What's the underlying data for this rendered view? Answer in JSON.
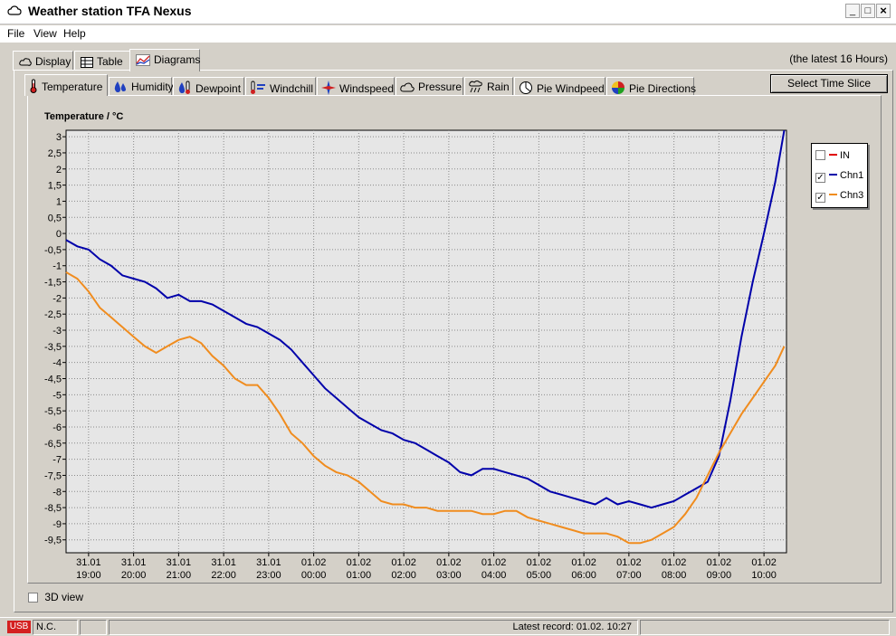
{
  "window": {
    "title": "Weather station TFA Nexus"
  },
  "menu": [
    "File",
    "View",
    "Help"
  ],
  "main_tabs": [
    {
      "label": "Display",
      "icon": "sun-icon"
    },
    {
      "label": "Table",
      "icon": "table-icon"
    },
    {
      "label": "Diagrams",
      "icon": "diagram-icon"
    }
  ],
  "latest_label": "(the latest 16 Hours)",
  "sub_tabs": [
    {
      "label": "Temperature",
      "icon": "thermometer-icon"
    },
    {
      "label": "Humidity",
      "icon": "humidity-icon"
    },
    {
      "label": "Dewpoint",
      "icon": "dewpoint-icon"
    },
    {
      "label": "Windchill",
      "icon": "windchill-icon"
    },
    {
      "label": "Windspeed",
      "icon": "windspeed-icon"
    },
    {
      "label": "Pressure",
      "icon": "pressure-icon"
    },
    {
      "label": "Rain",
      "icon": "rain-icon"
    },
    {
      "label": "Pie Windpeed",
      "icon": "pie-icon"
    },
    {
      "label": "Pie Directions",
      "icon": "compass-icon"
    }
  ],
  "select_button": "Select Time Slice",
  "view3d_label": "3D view",
  "status": {
    "usb": "USB",
    "connection": "N.C.",
    "latest_record": "Latest record: 01.02. 10:27"
  },
  "colors": {
    "chn1": "#0000aa",
    "chn3": "#f08c1e",
    "in": "#e00000",
    "plot_bg": "#e6e6e6"
  },
  "chart_data": {
    "type": "line",
    "title": "Temperature / °C",
    "ylim": [
      -9.9,
      3.2
    ],
    "yticks": [
      "3",
      "2,5",
      "2",
      "1,5",
      "1",
      "0,5",
      "0",
      "-0,5",
      "-1",
      "-1,5",
      "-2",
      "-2,5",
      "-3",
      "-3,5",
      "-4",
      "-4,5",
      "-5",
      "-5,5",
      "-6",
      "-6,5",
      "-7",
      "-7,5",
      "-8",
      "-8,5",
      "-9",
      "-9,5"
    ],
    "xlim": [
      18.5,
      10.5
    ],
    "xticks": [
      {
        "date": "31.01",
        "time": "19:00"
      },
      {
        "date": "31.01",
        "time": "20:00"
      },
      {
        "date": "31.01",
        "time": "21:00"
      },
      {
        "date": "31.01",
        "time": "22:00"
      },
      {
        "date": "31.01",
        "time": "23:00"
      },
      {
        "date": "01.02",
        "time": "00:00"
      },
      {
        "date": "01.02",
        "time": "01:00"
      },
      {
        "date": "01.02",
        "time": "02:00"
      },
      {
        "date": "01.02",
        "time": "03:00"
      },
      {
        "date": "01.02",
        "time": "04:00"
      },
      {
        "date": "01.02",
        "time": "05:00"
      },
      {
        "date": "01.02",
        "time": "06:00"
      },
      {
        "date": "01.02",
        "time": "07:00"
      },
      {
        "date": "01.02",
        "time": "08:00"
      },
      {
        "date": "01.02",
        "time": "09:00"
      },
      {
        "date": "01.02",
        "time": "10:00"
      }
    ],
    "grid": true,
    "legend_placement": "top-right",
    "series": [
      {
        "name": "IN",
        "checked": false,
        "values": []
      },
      {
        "name": "Chn1",
        "checked": true,
        "x": [
          "18:30",
          "18:45",
          "19:00",
          "19:15",
          "19:30",
          "19:45",
          "20:00",
          "20:15",
          "20:30",
          "20:45",
          "21:00",
          "21:15",
          "21:30",
          "21:45",
          "22:00",
          "22:15",
          "22:30",
          "22:45",
          "23:00",
          "23:15",
          "23:30",
          "23:45",
          "00:00",
          "00:15",
          "00:30",
          "00:45",
          "01:00",
          "01:15",
          "01:30",
          "01:45",
          "02:00",
          "02:15",
          "02:30",
          "02:45",
          "03:00",
          "03:15",
          "03:30",
          "03:45",
          "04:00",
          "04:15",
          "04:30",
          "04:45",
          "05:00",
          "05:15",
          "05:30",
          "05:45",
          "06:00",
          "06:15",
          "06:30",
          "06:45",
          "07:00",
          "07:15",
          "07:30",
          "07:45",
          "08:00",
          "08:15",
          "08:30",
          "08:45",
          "09:00",
          "09:15",
          "09:30",
          "09:45",
          "10:00",
          "10:15",
          "10:27"
        ],
        "values": [
          -0.2,
          -0.4,
          -0.5,
          -0.8,
          -1.0,
          -1.3,
          -1.4,
          -1.5,
          -1.7,
          -2.0,
          -1.9,
          -2.1,
          -2.1,
          -2.2,
          -2.4,
          -2.6,
          -2.8,
          -2.9,
          -3.1,
          -3.3,
          -3.6,
          -4.0,
          -4.4,
          -4.8,
          -5.1,
          -5.4,
          -5.7,
          -5.9,
          -6.1,
          -6.2,
          -6.4,
          -6.5,
          -6.7,
          -6.9,
          -7.1,
          -7.4,
          -7.5,
          -7.3,
          -7.3,
          -7.4,
          -7.5,
          -7.6,
          -7.8,
          -8.0,
          -8.1,
          -8.2,
          -8.3,
          -8.4,
          -8.2,
          -8.4,
          -8.3,
          -8.4,
          -8.5,
          -8.4,
          -8.3,
          -8.1,
          -7.9,
          -7.7,
          -6.9,
          -5.2,
          -3.2,
          -1.5,
          0.0,
          1.6,
          3.2
        ]
      },
      {
        "name": "Chn3",
        "checked": true,
        "x": [
          "18:30",
          "18:45",
          "19:00",
          "19:15",
          "19:30",
          "19:45",
          "20:00",
          "20:15",
          "20:30",
          "20:45",
          "21:00",
          "21:15",
          "21:30",
          "21:45",
          "22:00",
          "22:15",
          "22:30",
          "22:45",
          "23:00",
          "23:15",
          "23:30",
          "23:45",
          "00:00",
          "00:15",
          "00:30",
          "00:45",
          "01:00",
          "01:15",
          "01:30",
          "01:45",
          "02:00",
          "02:15",
          "02:30",
          "02:45",
          "03:00",
          "03:15",
          "03:30",
          "03:45",
          "04:00",
          "04:15",
          "04:30",
          "04:45",
          "05:00",
          "05:15",
          "05:30",
          "05:45",
          "06:00",
          "06:15",
          "06:30",
          "06:45",
          "07:00",
          "07:15",
          "07:30",
          "07:45",
          "08:00",
          "08:15",
          "08:30",
          "08:45",
          "09:00",
          "09:15",
          "09:30",
          "09:45",
          "10:00",
          "10:15",
          "10:27"
        ],
        "values": [
          -1.2,
          -1.4,
          -1.8,
          -2.3,
          -2.6,
          -2.9,
          -3.2,
          -3.5,
          -3.7,
          -3.5,
          -3.3,
          -3.2,
          -3.4,
          -3.8,
          -4.1,
          -4.5,
          -4.7,
          -4.7,
          -5.1,
          -5.6,
          -6.2,
          -6.5,
          -6.9,
          -7.2,
          -7.4,
          -7.5,
          -7.7,
          -8.0,
          -8.3,
          -8.4,
          -8.4,
          -8.5,
          -8.5,
          -8.6,
          -8.6,
          -8.6,
          -8.6,
          -8.7,
          -8.7,
          -8.6,
          -8.6,
          -8.8,
          -8.9,
          -9.0,
          -9.1,
          -9.2,
          -9.3,
          -9.3,
          -9.3,
          -9.4,
          -9.6,
          -9.6,
          -9.5,
          -9.3,
          -9.1,
          -8.7,
          -8.2,
          -7.5,
          -6.8,
          -6.2,
          -5.6,
          -5.1,
          -4.6,
          -4.1,
          -3.5
        ]
      }
    ]
  }
}
